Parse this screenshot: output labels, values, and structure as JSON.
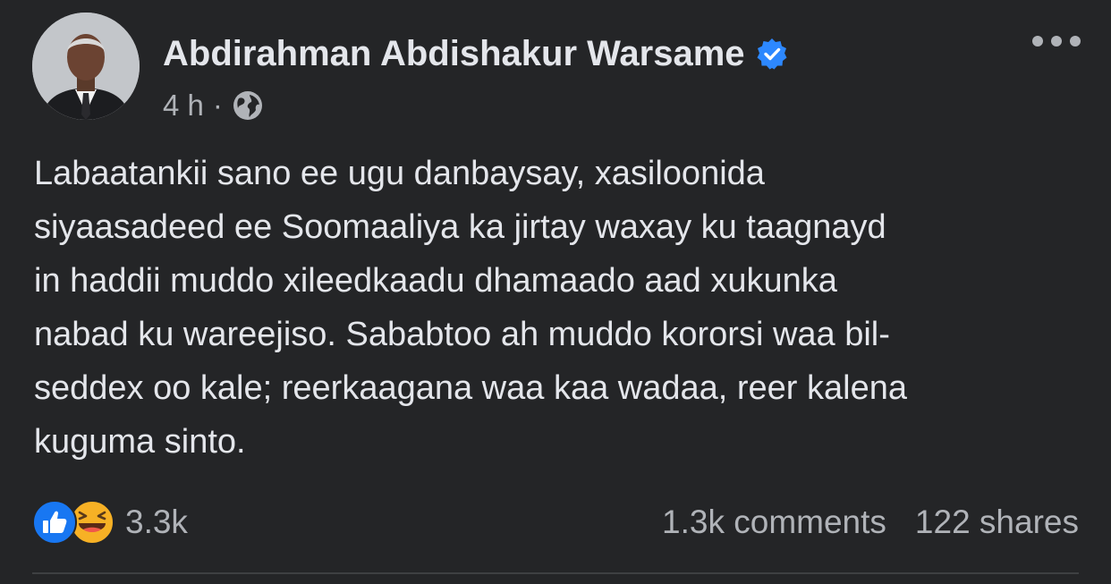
{
  "post": {
    "author_name": "Abdirahman Abdishakur Warsame",
    "verified_icon": "verified-badge-icon",
    "timestamp": "4 h",
    "separator": "·",
    "privacy_icon": "globe-icon",
    "more_icon": "more-options-icon",
    "content_lines": [
      "Labaatankii sano ee ugu danbaysay, xasiloonida",
      "siyaasadeed ee Soomaaliya ka jirtay waxay ku taagnayd",
      "in haddii muddo xileedkaadu dhamaado aad xukunka",
      "nabad ku wareejiso. Sababtoo ah muddo kororsi waa bil-",
      "seddex oo kale; reerkaagana waa kaa wadaa, reer kalena",
      "kuguma sinto."
    ]
  },
  "engagement": {
    "reaction_icons": [
      "like-reaction-icon",
      "haha-reaction-icon"
    ],
    "reaction_count": "3.3k",
    "comments": "1.3k comments",
    "shares": "122 shares"
  },
  "colors": {
    "background": "#242527",
    "primary_text": "#e4e6eb",
    "secondary_text": "#b0b3b8",
    "verified_blue": "#2d88ff",
    "like_blue": "#1877f2",
    "haha_yellow": "#f7b125"
  }
}
